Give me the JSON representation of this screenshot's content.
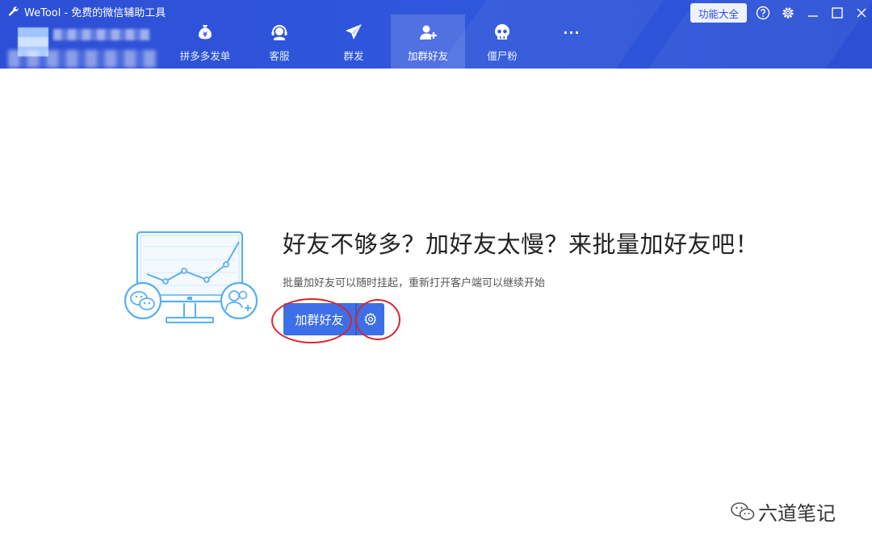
{
  "window": {
    "title": "WeTool - 免费的微信辅助工具",
    "func_button": "功能大全"
  },
  "tabs": [
    {
      "label": "拼多多发单",
      "icon": "money-bag-icon",
      "active": false
    },
    {
      "label": "客服",
      "icon": "headset-icon",
      "active": false
    },
    {
      "label": "群发",
      "icon": "paper-plane-icon",
      "active": false
    },
    {
      "label": "加群好友",
      "icon": "add-user-icon",
      "active": true
    },
    {
      "label": "僵尸粉",
      "icon": "skull-icon",
      "active": false
    },
    {
      "label": "···",
      "icon": "more-icon",
      "active": false
    }
  ],
  "main": {
    "headline": "好友不够多？加好友太慢？来批量加好友吧！",
    "subtext": "批量加好友可以随时挂起，重新打开客户端可以继续开始",
    "primary_button": "加群好友"
  },
  "watermark": {
    "text": "六道笔记"
  },
  "colors": {
    "header": "#2d4fd6",
    "accent": "#3d6fe8",
    "annotation": "#d8262b",
    "illustration": "#5aaef0"
  }
}
